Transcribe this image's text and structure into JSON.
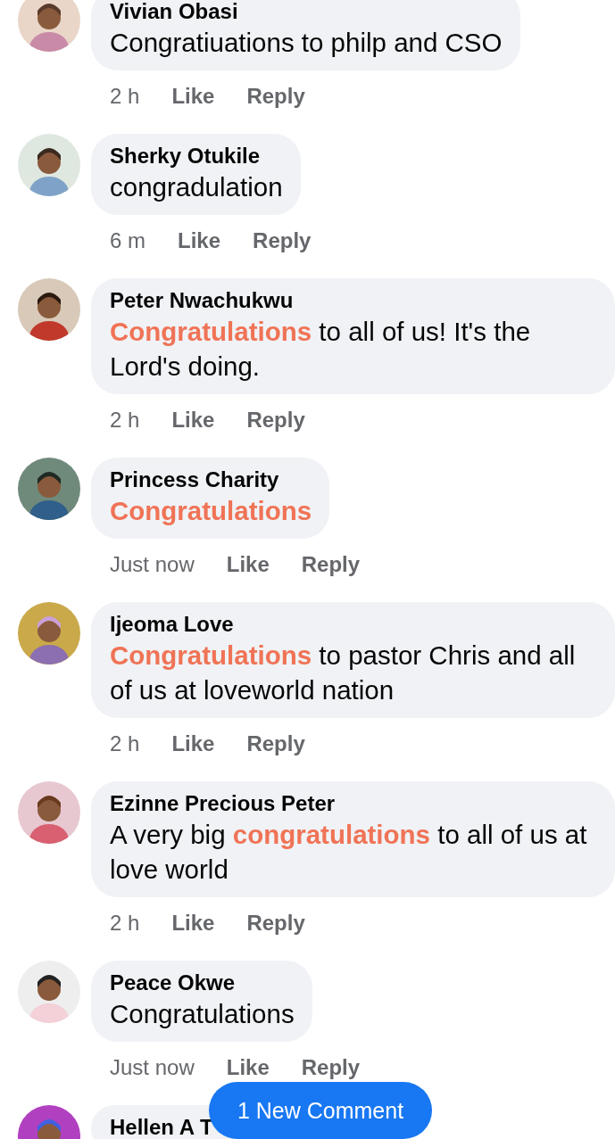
{
  "comments": [
    {
      "author": "Vivian Obasi",
      "body": [
        {
          "text": "Congratiuations to philp and CSO",
          "highlight": false
        }
      ],
      "time": "2 h",
      "like": "Like",
      "reply": "Reply"
    },
    {
      "author": "Sherky Otukile",
      "body": [
        {
          "text": "congradulation",
          "highlight": false
        }
      ],
      "time": "6 m",
      "like": "Like",
      "reply": "Reply"
    },
    {
      "author": "Peter Nwachukwu",
      "body": [
        {
          "text": "Congratulations",
          "highlight": true
        },
        {
          "text": " to all of us! It's the Lord's doing.",
          "highlight": false
        }
      ],
      "time": "2 h",
      "like": "Like",
      "reply": "Reply"
    },
    {
      "author": "Princess Charity",
      "body": [
        {
          "text": "Congratulations",
          "highlight": true
        }
      ],
      "time": "Just now",
      "like": "Like",
      "reply": "Reply"
    },
    {
      "author": "Ijeoma Love",
      "body": [
        {
          "text": "Congratulations",
          "highlight": true
        },
        {
          "text": " to pastor Chris and all of us at loveworld nation",
          "highlight": false
        }
      ],
      "time": "2 h",
      "like": "Like",
      "reply": "Reply"
    },
    {
      "author": "Ezinne Precious Peter",
      "body": [
        {
          "text": "A very big ",
          "highlight": false
        },
        {
          "text": "congratulations",
          "highlight": true
        },
        {
          "text": " to all of us at love world",
          "highlight": false
        }
      ],
      "time": "2 h",
      "like": "Like",
      "reply": "Reply"
    },
    {
      "author": "Peace Okwe",
      "body": [
        {
          "text": "Congratulations",
          "highlight": false
        }
      ],
      "time": "Just now",
      "like": "Like",
      "reply": "Reply"
    },
    {
      "author": "Hellen A T"
    }
  ],
  "new_comment_button": "1 New Comment"
}
